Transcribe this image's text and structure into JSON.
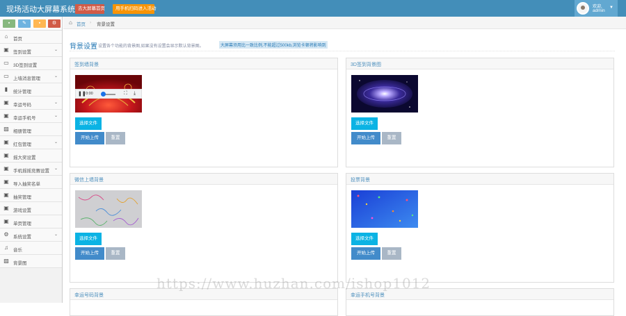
{
  "header": {
    "title": "现场活动大屏幕系统",
    "btn_screen": "去大屏幕首页",
    "btn_mobile": "用手机扫码进入活动",
    "user_greeting": "欢迎,",
    "user_name": "admin"
  },
  "shortcuts": [
    {
      "icon": "chat-icon",
      "glyph": "💬",
      "color": "#87b87f"
    },
    {
      "icon": "pencil-icon",
      "glyph": "✎",
      "color": "#6fb3e0"
    },
    {
      "icon": "users-icon",
      "glyph": "👥",
      "color": "#ffb752"
    },
    {
      "icon": "cogs-icon",
      "glyph": "⚙",
      "color": "#d15b47"
    }
  ],
  "sidebar": {
    "items": [
      {
        "label": "首页",
        "icon": "home-icon",
        "glyph": "⌂",
        "chevron": false
      },
      {
        "label": "签到设置",
        "icon": "gift-icon",
        "glyph": "▣",
        "chevron": true
      },
      {
        "label": "3D签到设置",
        "icon": "monitor-icon",
        "glyph": "▭",
        "chevron": false
      },
      {
        "label": "上墙消息管理",
        "icon": "desktop-icon",
        "glyph": "▭",
        "chevron": true
      },
      {
        "label": "统计管理",
        "icon": "signal-icon",
        "glyph": "▮",
        "chevron": false
      },
      {
        "label": "幸运号码",
        "icon": "gift-icon",
        "glyph": "▣",
        "chevron": true
      },
      {
        "label": "幸运手机号",
        "icon": "gift-icon",
        "glyph": "▣",
        "chevron": true
      },
      {
        "label": "相册管理",
        "icon": "picture-icon",
        "glyph": "▨",
        "chevron": false
      },
      {
        "label": "红包管理",
        "icon": "gift-icon",
        "glyph": "▣",
        "chevron": true
      },
      {
        "label": "摇大奖设置",
        "icon": "gift-icon",
        "glyph": "▣",
        "chevron": false
      },
      {
        "label": "手机摇摇竞赛设置",
        "icon": "gift-icon",
        "glyph": "▣",
        "chevron": true
      },
      {
        "label": "导入抽奖名单",
        "icon": "gift-icon",
        "glyph": "▣",
        "chevron": false
      },
      {
        "label": "抽奖管理",
        "icon": "gift-icon",
        "glyph": "▣",
        "chevron": false
      },
      {
        "label": "游戏设置",
        "icon": "gift-icon",
        "glyph": "▣",
        "chevron": false
      },
      {
        "label": "单页管理",
        "icon": "gift-icon",
        "glyph": "▣",
        "chevron": false
      },
      {
        "label": "系统设置",
        "icon": "cog-icon",
        "glyph": "⚙",
        "chevron": true
      },
      {
        "label": "音乐",
        "icon": "music-icon",
        "glyph": "♫",
        "chevron": false
      },
      {
        "label": "背景图",
        "icon": "picture-icon",
        "glyph": "▨",
        "chevron": false
      }
    ]
  },
  "breadcrumb": {
    "home": "首页",
    "separator": "›",
    "current": "背景设置"
  },
  "page": {
    "title": "背景设置",
    "description": "设置各个功能的背景图,如果没有设置会显示默认背景图。",
    "note": "大屏幕须用比一致比例,不能超过500kb,浏览卡顿将影响到"
  },
  "panels": [
    {
      "title": "签到墙背景",
      "has_video": true,
      "video_time": "0:00",
      "choose": "选择文件",
      "upload": "开始上传",
      "reset": "重置"
    },
    {
      "title": "3D签到背景图",
      "has_video": false,
      "choose": "选择文件",
      "upload": "开始上传",
      "reset": "重置"
    },
    {
      "title": "微信上墙背景",
      "has_video": false,
      "choose": "选择文件",
      "upload": "开始上传",
      "reset": "重置"
    },
    {
      "title": "投票背景",
      "has_video": false,
      "choose": "选择文件",
      "upload": "开始上传",
      "reset": "重置"
    },
    {
      "title": "幸运号码背景"
    },
    {
      "title": "幸运手机号背景"
    }
  ],
  "watermark": "https://www.huzhan.com/ishop1012",
  "colors": {
    "header": "#438eb9",
    "link": "#2679b5",
    "choose_btn": "#0bb3e4",
    "upload_btn": "#428bca"
  }
}
